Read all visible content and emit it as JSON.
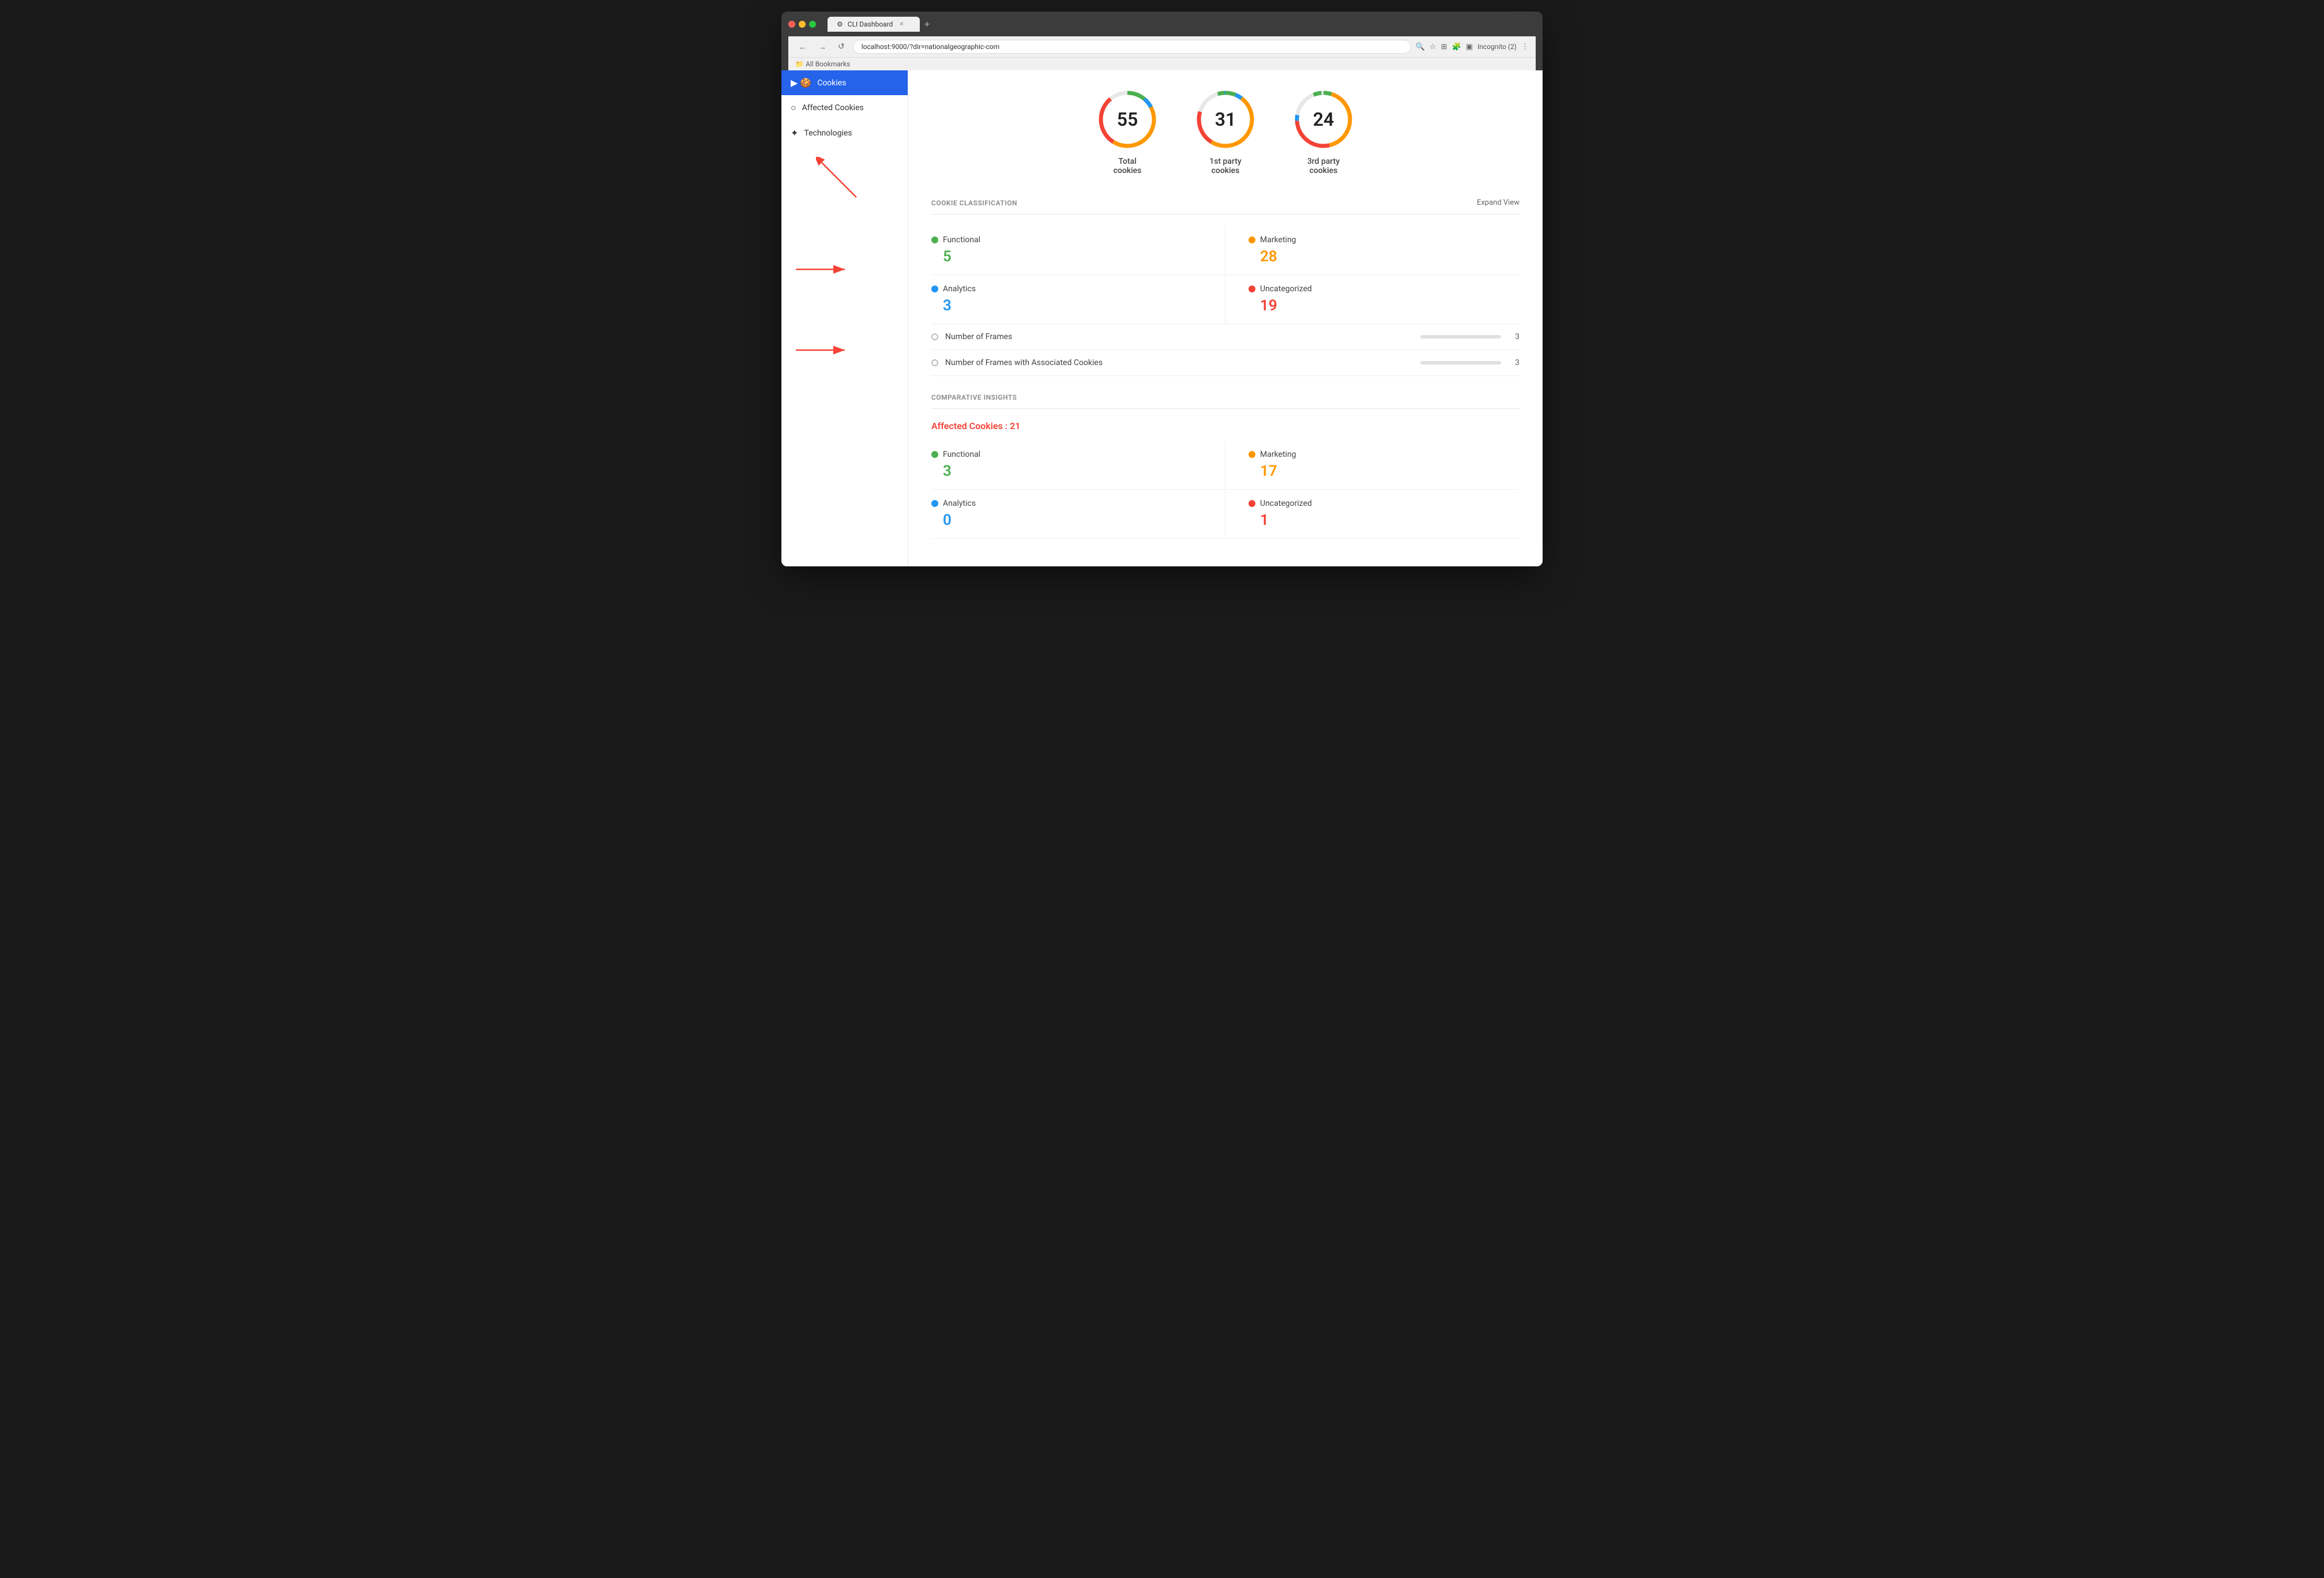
{
  "browser": {
    "tab_title": "CLI Dashboard",
    "url": "localhost:9000/?dir=nationalgeographic-com",
    "incognito_label": "Incognito (2)",
    "bookmarks_label": "All Bookmarks",
    "new_tab_symbol": "+",
    "back_symbol": "←",
    "forward_symbol": "→",
    "refresh_symbol": "↺"
  },
  "sidebar": {
    "items": [
      {
        "id": "cookies",
        "label": "Cookies",
        "icon": "🍪",
        "active": true
      },
      {
        "id": "affected-cookies",
        "label": "Affected Cookies",
        "icon": "○"
      },
      {
        "id": "technologies",
        "label": "Technologies",
        "icon": "✦"
      }
    ]
  },
  "stats": [
    {
      "id": "total",
      "value": "55",
      "label": "Total\ncookies",
      "color": "#4caf50"
    },
    {
      "id": "first-party",
      "value": "31",
      "label": "1st party\ncookies",
      "color": "#2196f3"
    },
    {
      "id": "third-party",
      "value": "24",
      "label": "3rd party\ncookies",
      "color": "#ff9800"
    }
  ],
  "cookie_classification": {
    "title": "COOKIE CLASSIFICATION",
    "expand_label": "Expand View",
    "items": [
      {
        "id": "functional",
        "label": "Functional",
        "value": "5",
        "color_class": "dot-green",
        "val_class": "val-green",
        "side": "left"
      },
      {
        "id": "marketing",
        "label": "Marketing",
        "value": "28",
        "color_class": "dot-orange",
        "val_class": "val-orange",
        "side": "right"
      },
      {
        "id": "analytics",
        "label": "Analytics",
        "value": "3",
        "color_class": "dot-blue",
        "val_class": "val-blue",
        "side": "left"
      },
      {
        "id": "uncategorized",
        "label": "Uncategorized",
        "value": "19",
        "color_class": "dot-red",
        "val_class": "val-red",
        "side": "right"
      }
    ]
  },
  "frames": {
    "items": [
      {
        "id": "number-of-frames",
        "label": "Number of Frames",
        "value": "3"
      },
      {
        "id": "frames-with-cookies",
        "label": "Number of Frames with Associated Cookies",
        "value": "3"
      }
    ]
  },
  "comparative_insights": {
    "title": "COMPARATIVE INSIGHTS",
    "affected_label": "Affected Cookies : 21",
    "items": [
      {
        "id": "functional",
        "label": "Functional",
        "value": "3",
        "color_class": "dot-green",
        "val_class": "val-green",
        "side": "left"
      },
      {
        "id": "marketing",
        "label": "Marketing",
        "value": "17",
        "color_class": "dot-orange",
        "val_class": "val-orange",
        "side": "right"
      },
      {
        "id": "analytics",
        "label": "Analytics",
        "value": "0",
        "color_class": "dot-blue",
        "val_class": "val-blue",
        "side": "left"
      },
      {
        "id": "uncategorized",
        "label": "Uncategorized",
        "value": "1",
        "color_class": "dot-red",
        "val_class": "val-red",
        "side": "right"
      }
    ]
  }
}
